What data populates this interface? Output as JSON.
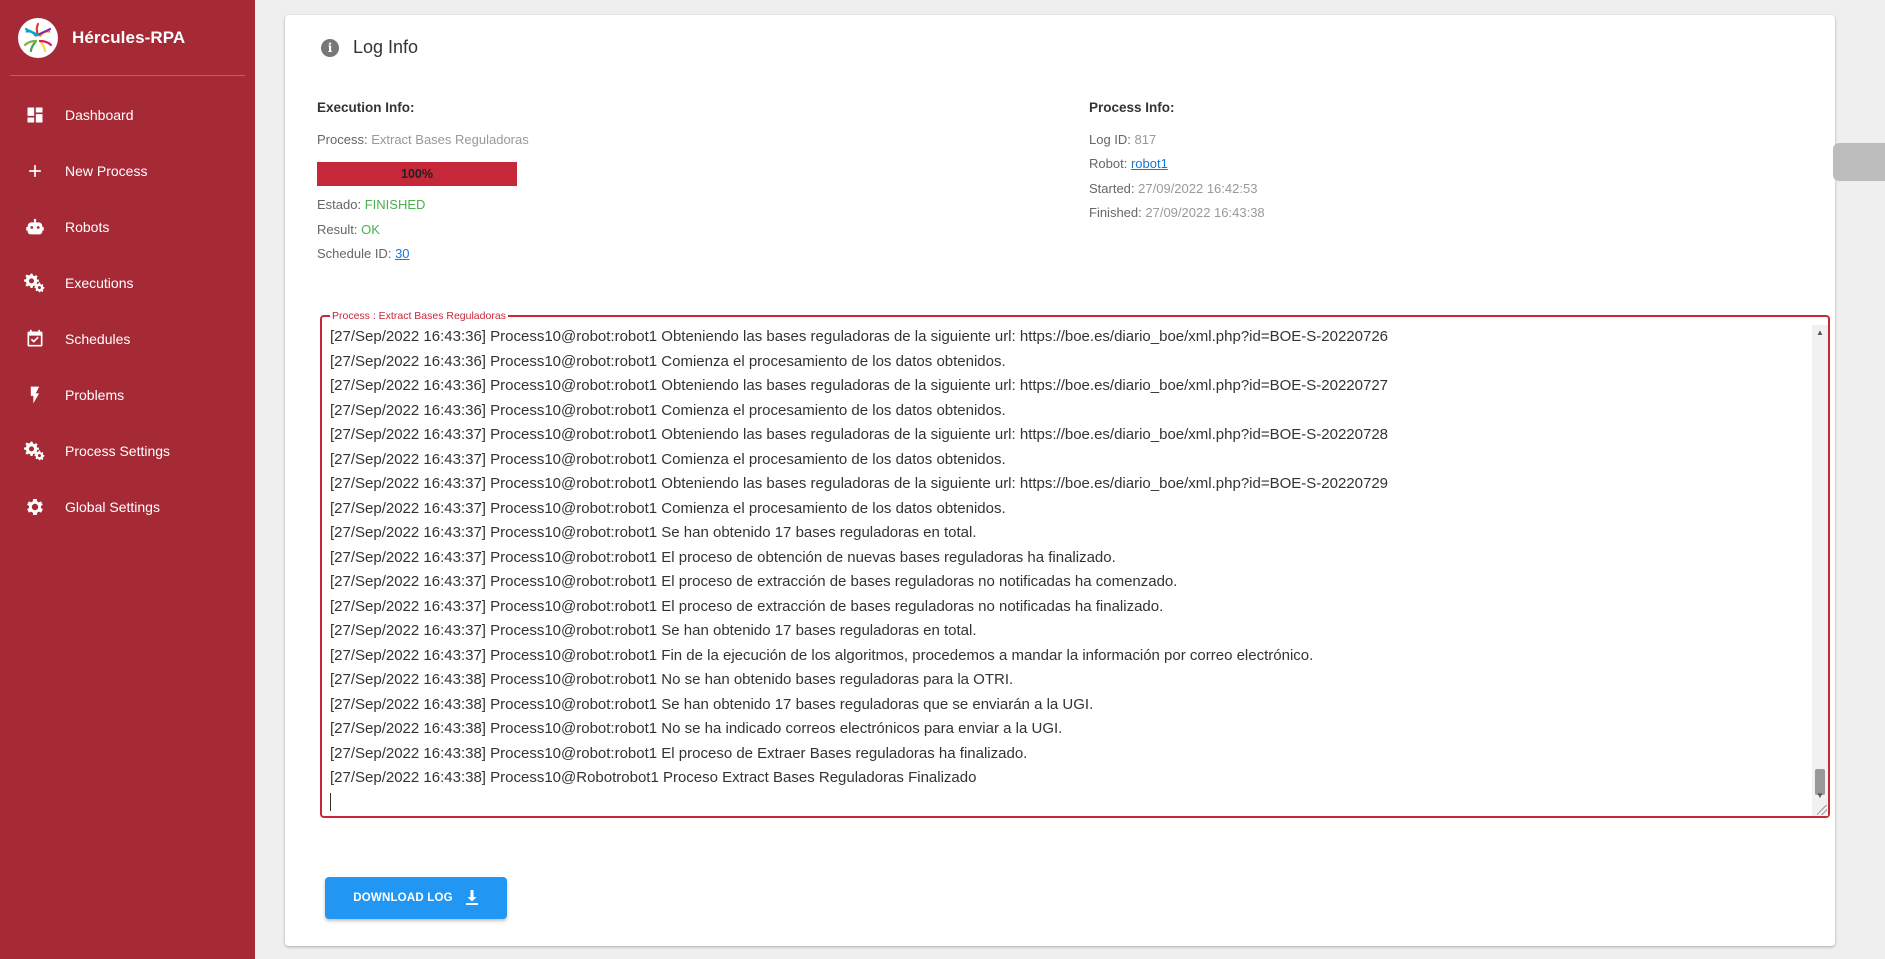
{
  "app": {
    "name": "Hércules-RPA"
  },
  "sidebar": {
    "items": [
      {
        "label": "Dashboard",
        "icon": "dashboard-icon"
      },
      {
        "label": "New Process",
        "icon": "plus-icon"
      },
      {
        "label": "Robots",
        "icon": "robot-icon"
      },
      {
        "label": "Executions",
        "icon": "gears-icon"
      },
      {
        "label": "Schedules",
        "icon": "calendar-check-icon"
      },
      {
        "label": "Problems",
        "icon": "bolt-icon"
      },
      {
        "label": "Process Settings",
        "icon": "gears-icon"
      },
      {
        "label": "Global Settings",
        "icon": "gear-icon"
      }
    ]
  },
  "card": {
    "title": "Log Info",
    "execution": {
      "heading": "Execution Info:",
      "process_label": "Process:",
      "process_value": "Extract Bases Reguladoras",
      "progress": "100%",
      "progress_fraction": 1.0,
      "estado_label": "Estado:",
      "estado_value": "FINISHED",
      "result_label": "Result:",
      "result_value": "OK",
      "schedule_label": "Schedule ID:",
      "schedule_value": "30"
    },
    "process": {
      "heading": "Process Info:",
      "log_id_label": "Log ID:",
      "log_id_value": "817",
      "robot_label": "Robot:",
      "robot_value": "robot1",
      "started_label": "Started:",
      "started_value": "27/09/2022 16:42:53",
      "finished_label": "Finished:",
      "finished_value": "27/09/2022 16:43:38"
    },
    "log": {
      "legend": "Process : Extract Bases Reguladoras",
      "lines": [
        "[27/Sep/2022 16:43:36] Process10@robot:robot1 Obteniendo las bases reguladoras de la siguiente url: https://boe.es/diario_boe/xml.php?id=BOE-S-20220726",
        "[27/Sep/2022 16:43:36] Process10@robot:robot1 Comienza el procesamiento de los datos obtenidos.",
        "[27/Sep/2022 16:43:36] Process10@robot:robot1 Obteniendo las bases reguladoras de la siguiente url: https://boe.es/diario_boe/xml.php?id=BOE-S-20220727",
        "[27/Sep/2022 16:43:36] Process10@robot:robot1 Comienza el procesamiento de los datos obtenidos.",
        "[27/Sep/2022 16:43:37] Process10@robot:robot1 Obteniendo las bases reguladoras de la siguiente url: https://boe.es/diario_boe/xml.php?id=BOE-S-20220728",
        "[27/Sep/2022 16:43:37] Process10@robot:robot1 Comienza el procesamiento de los datos obtenidos.",
        "[27/Sep/2022 16:43:37] Process10@robot:robot1 Obteniendo las bases reguladoras de la siguiente url: https://boe.es/diario_boe/xml.php?id=BOE-S-20220729",
        "[27/Sep/2022 16:43:37] Process10@robot:robot1 Comienza el procesamiento de los datos obtenidos.",
        "[27/Sep/2022 16:43:37] Process10@robot:robot1 Se han obtenido 17 bases reguladoras en total.",
        "[27/Sep/2022 16:43:37] Process10@robot:robot1 El proceso de obtención de nuevas bases reguladoras ha finalizado.",
        "[27/Sep/2022 16:43:37] Process10@robot:robot1 El proceso de extracción de bases reguladoras no notificadas ha comenzado.",
        "[27/Sep/2022 16:43:37] Process10@robot:robot1 El proceso de extracción de bases reguladoras no notificadas ha finalizado.",
        "[27/Sep/2022 16:43:37] Process10@robot:robot1 Se han obtenido 17 bases reguladoras en total.",
        "[27/Sep/2022 16:43:37] Process10@robot:robot1 Fin de la ejecución de los algoritmos, procedemos a mandar la información por correo electrónico.",
        "[27/Sep/2022 16:43:38] Process10@robot:robot1 No se han obtenido bases reguladoras para la OTRI.",
        "[27/Sep/2022 16:43:38] Process10@robot:robot1 Se han obtenido 17 bases reguladoras que se enviarán a la UGI.",
        "[27/Sep/2022 16:43:38] Process10@robot:robot1 No se ha indicado correos electrónicos para enviar a la UGI.",
        "[27/Sep/2022 16:43:38] Process10@robot:robot1 El proceso de Extraer Bases reguladoras ha finalizado.",
        "[27/Sep/2022 16:43:38] Process10@Robotrobot1 Proceso Extract Bases Reguladoras Finalizado"
      ]
    },
    "download_label": "DOWNLOAD LOG"
  },
  "colors": {
    "sidebar": "#a52a36",
    "accent": "#c62839",
    "success": "#4caf50",
    "button": "#2196f3",
    "link": "#1976d2"
  }
}
